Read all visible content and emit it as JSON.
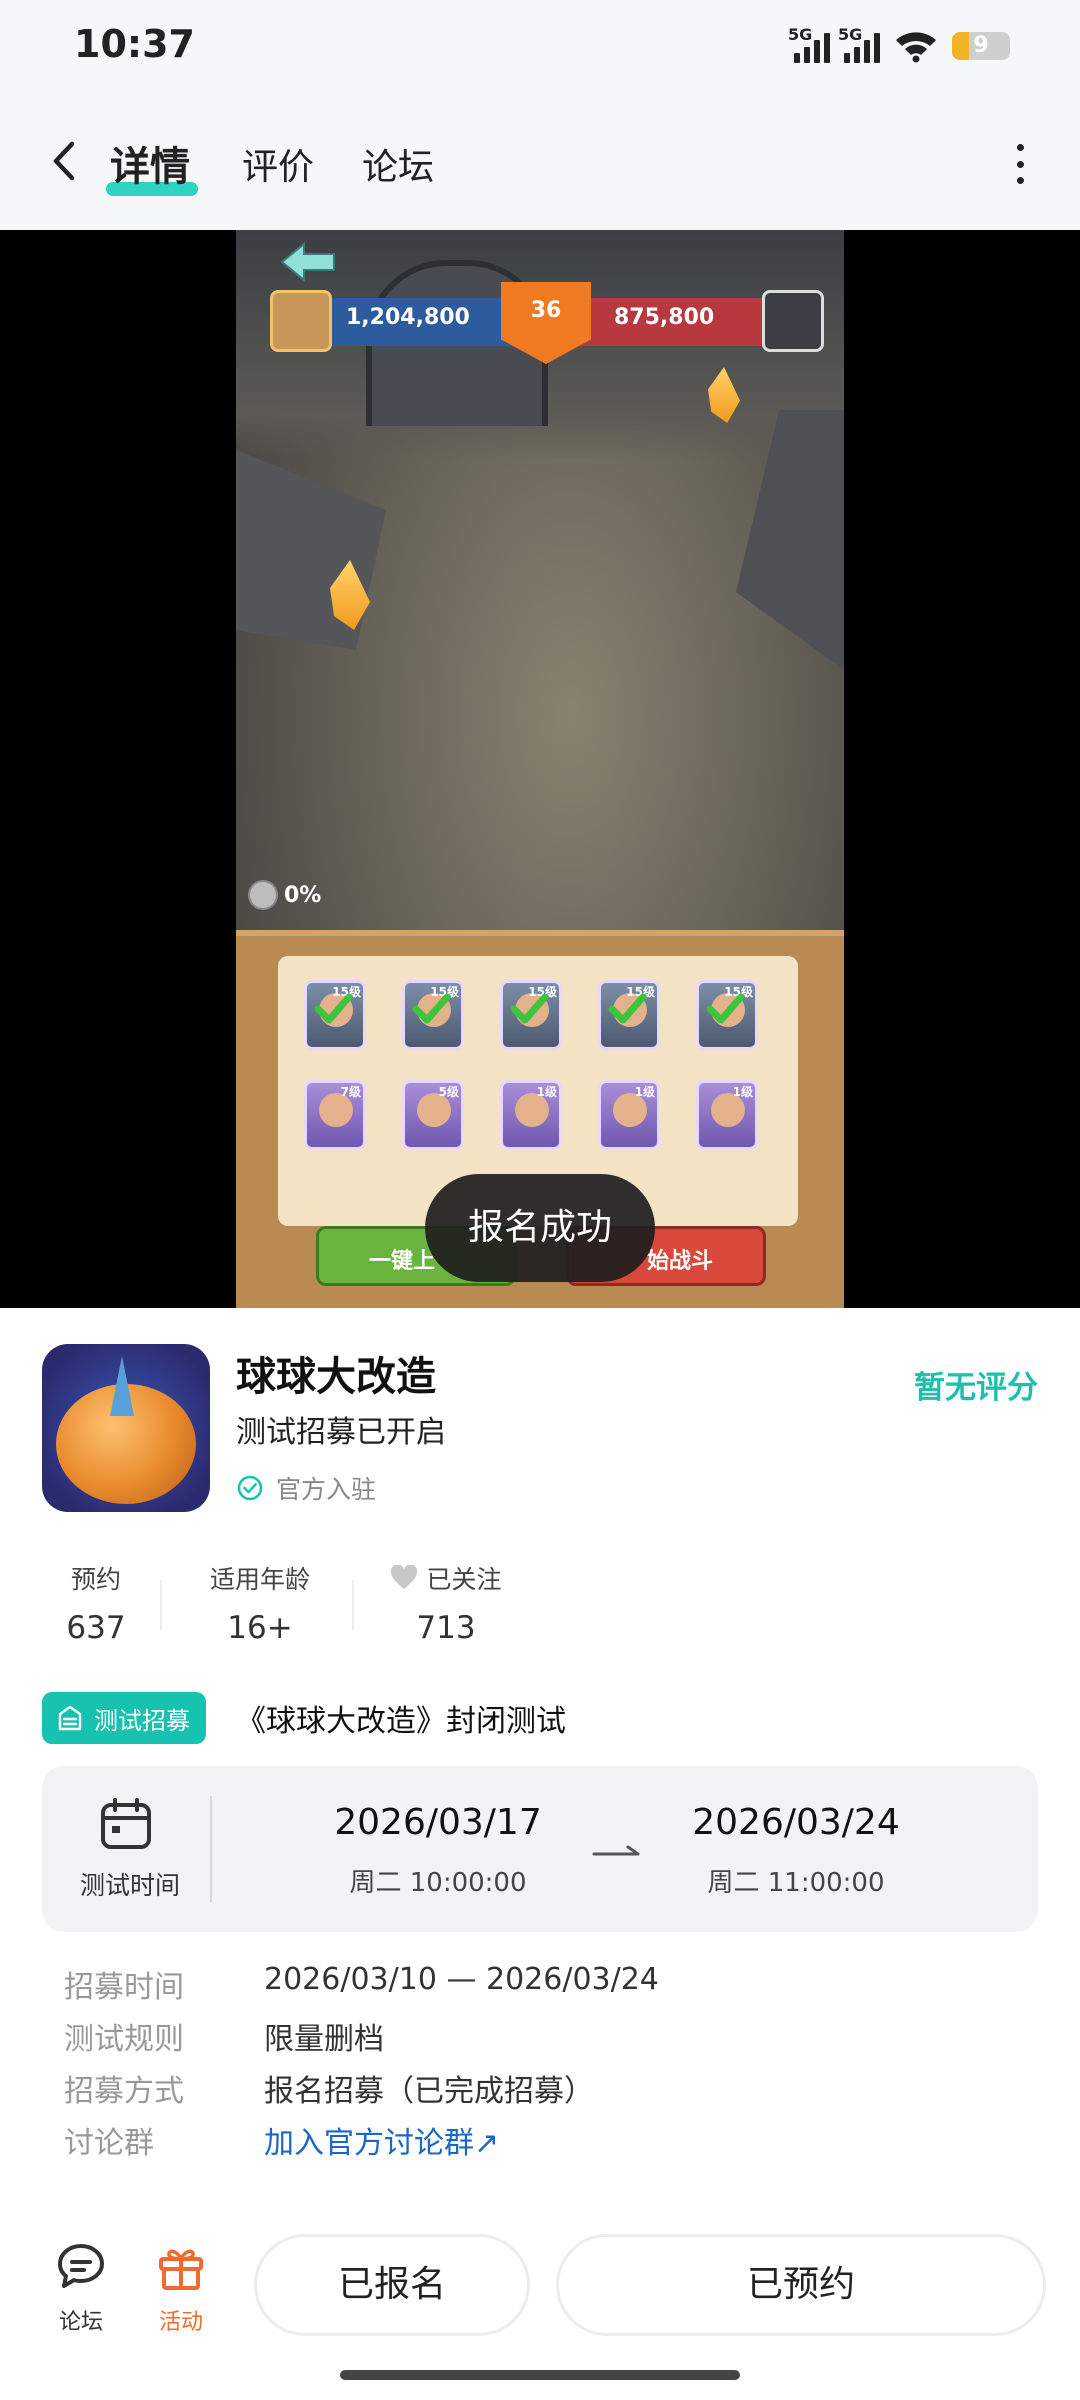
{
  "status_bar": {
    "time": "10:37",
    "signal_1_label": "5G",
    "signal_2_label": "5G",
    "battery_level": "9",
    "icons": [
      "signal-icon",
      "signal-icon",
      "wifi-icon",
      "battery-icon"
    ]
  },
  "header": {
    "tabs": [
      {
        "label": "详情",
        "active": true
      },
      {
        "label": "评价",
        "active": false
      },
      {
        "label": "论坛",
        "active": false
      }
    ],
    "accent_color": "#2fd3c2"
  },
  "video": {
    "hud": {
      "left_score": "1,204,800",
      "level": "36",
      "right_score": "875,800"
    },
    "progress_text": "0%",
    "cards": [
      {
        "level": "15级",
        "selected": true
      },
      {
        "level": "15级",
        "selected": true
      },
      {
        "level": "15级",
        "selected": true
      },
      {
        "level": "15级",
        "selected": true
      },
      {
        "level": "15级",
        "selected": true
      },
      {
        "level": "7级",
        "selected": false
      },
      {
        "level": "5级",
        "selected": false
      },
      {
        "level": "1级",
        "selected": false
      },
      {
        "level": "1级",
        "selected": false
      },
      {
        "level": "1级",
        "selected": false
      }
    ],
    "button_left": "一键上",
    "button_right": "始战斗",
    "toast": "报名成功"
  },
  "game": {
    "title": "球球大改造",
    "subtitle": "测试招募已开启",
    "official_label": "官方入驻",
    "rating": "暂无评分",
    "stats": [
      {
        "key": "预约",
        "value": "637"
      },
      {
        "key": "适用年龄",
        "value": "16+"
      },
      {
        "key": "已关注",
        "value": "713"
      }
    ]
  },
  "test": {
    "tag": "测试招募",
    "title": "《球球大改造》封闭测试",
    "time_label": "测试时间",
    "start_date": "2026/03/17",
    "start_time": "周二  10:00:00",
    "end_date": "2026/03/24",
    "end_time": "周二  11:00:00",
    "rows": [
      {
        "key": "招募时间",
        "value": "2026/03/10 — 2026/03/24"
      },
      {
        "key": "测试规则",
        "value": "限量删档"
      },
      {
        "key": "招募方式",
        "value": "报名招募（已完成招募）"
      },
      {
        "key": "讨论群",
        "value": "加入官方讨论群↗"
      }
    ]
  },
  "bottom_bar": {
    "forum_label": "论坛",
    "activity_label": "活动",
    "registered_label": "已报名",
    "reserved_label": "已预约",
    "activity_color": "#f26a2f"
  }
}
